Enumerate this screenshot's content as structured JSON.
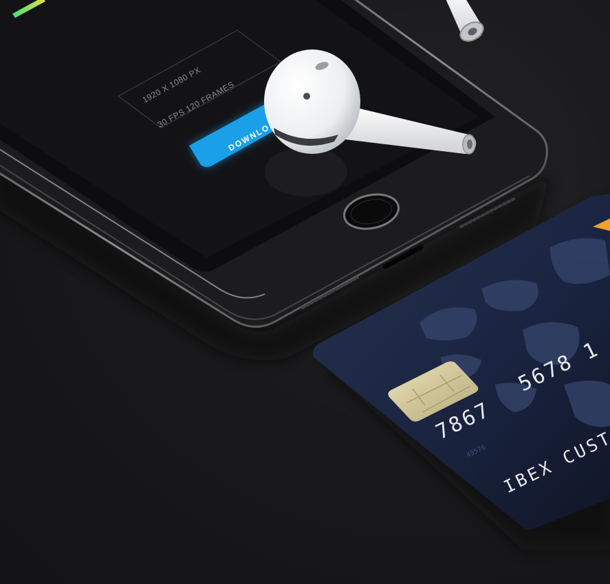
{
  "screen": {
    "resolution_text": "1920 X 1080 PX",
    "specs_text": "30 FPS   120 FRAMES",
    "download_label": "DOWNLOAD"
  },
  "card": {
    "number_top": "5678 1",
    "number_main": "7867",
    "small_code": "49576",
    "holder_name": "IBEX CUSTOMER"
  },
  "colors": {
    "background": "#18181a",
    "download_button": "#1aa0e8",
    "card_navy": "#1b2640",
    "chip_gold": "#d8cfa6"
  }
}
